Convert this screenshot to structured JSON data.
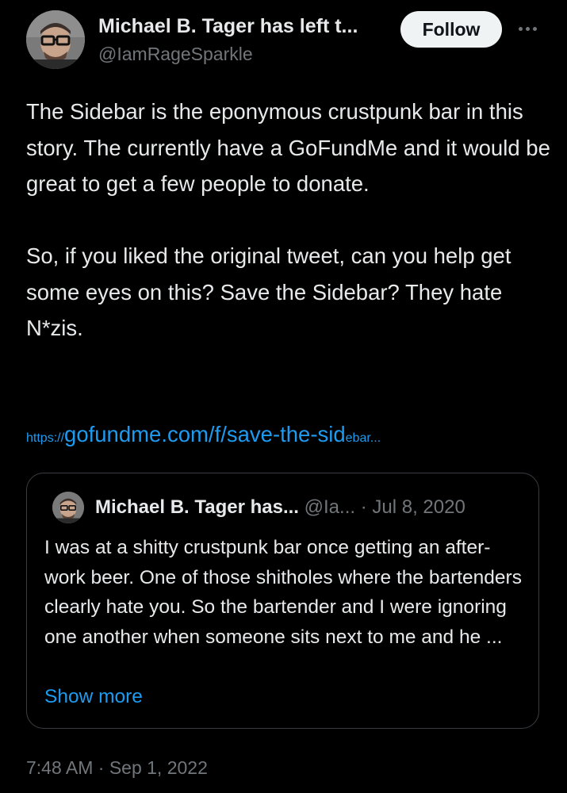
{
  "author": {
    "name": "Michael B. Tager has left t...",
    "handle": "@IamRageSparkle",
    "follow_label": "Follow"
  },
  "tweet": {
    "paragraphs": [
      "The Sidebar is the eponymous crustpunk bar in this story. The currently have a GoFundMe and it would be great to get a few people to donate.",
      "So, if you liked the original tweet, can you help get some eyes on this? Save the Sidebar? They hate N*zis."
    ],
    "link": {
      "prefix": "https://",
      "main": "gofundme.com/f/save-the-sid",
      "suffix": "ebar..."
    },
    "timestamp": "7:48 AM · Sep 1, 2022"
  },
  "quoted_tweet": {
    "author_name": "Michael B. Tager has...",
    "handle": "@Ia...",
    "separator": "·",
    "date": "Jul 8, 2020",
    "text": "I was at a shitty crustpunk bar once getting an after-work beer. One of those shitholes where the bartenders clearly hate you. So the bartender and I were ignoring one another when someone sits next to me and he ...",
    "show_more_label": "Show more"
  },
  "icons": {
    "more": "more-horizontal-icon",
    "avatar": "user-avatar"
  },
  "colors": {
    "background": "#000000",
    "text": "#e7e9ea",
    "secondary": "#71767b",
    "link": "#1d9bf0",
    "follow_bg": "#eff3f4",
    "border": "#3a3e42"
  }
}
